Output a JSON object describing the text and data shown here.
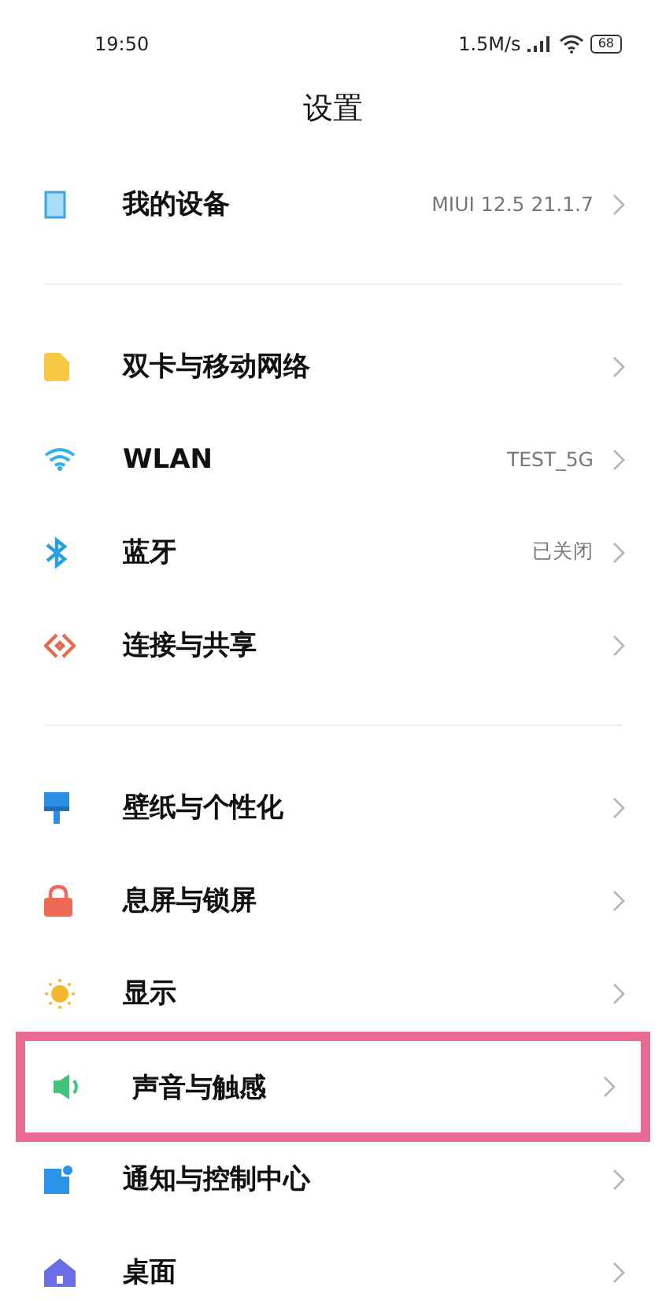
{
  "status_bar": {
    "time": "19:50",
    "speed": "1.5M/s",
    "battery": "68"
  },
  "title": "设置",
  "sections": [
    {
      "items": [
        {
          "label": "我的设备",
          "value": "MIUI 12.5 21.1.7",
          "highlighted": false
        }
      ]
    },
    {
      "items": [
        {
          "label": "双卡与移动网络",
          "highlighted": false
        },
        {
          "label": "WLAN",
          "value": "TEST_5G",
          "highlighted": false
        },
        {
          "label": "蓝牙",
          "value": "已关闭",
          "highlighted": false
        },
        {
          "label": "连接与共享",
          "highlighted": false
        }
      ]
    },
    {
      "items": [
        {
          "label": "壁纸与个性化",
          "highlighted": false
        },
        {
          "label": "息屏与锁屏",
          "highlighted": false
        },
        {
          "label": "显示",
          "highlighted": false
        },
        {
          "label": "声音与触感",
          "highlighted": true
        },
        {
          "label": "通知与控制中心",
          "highlighted": false
        },
        {
          "label": "桌面",
          "highlighted": false
        }
      ]
    }
  ]
}
